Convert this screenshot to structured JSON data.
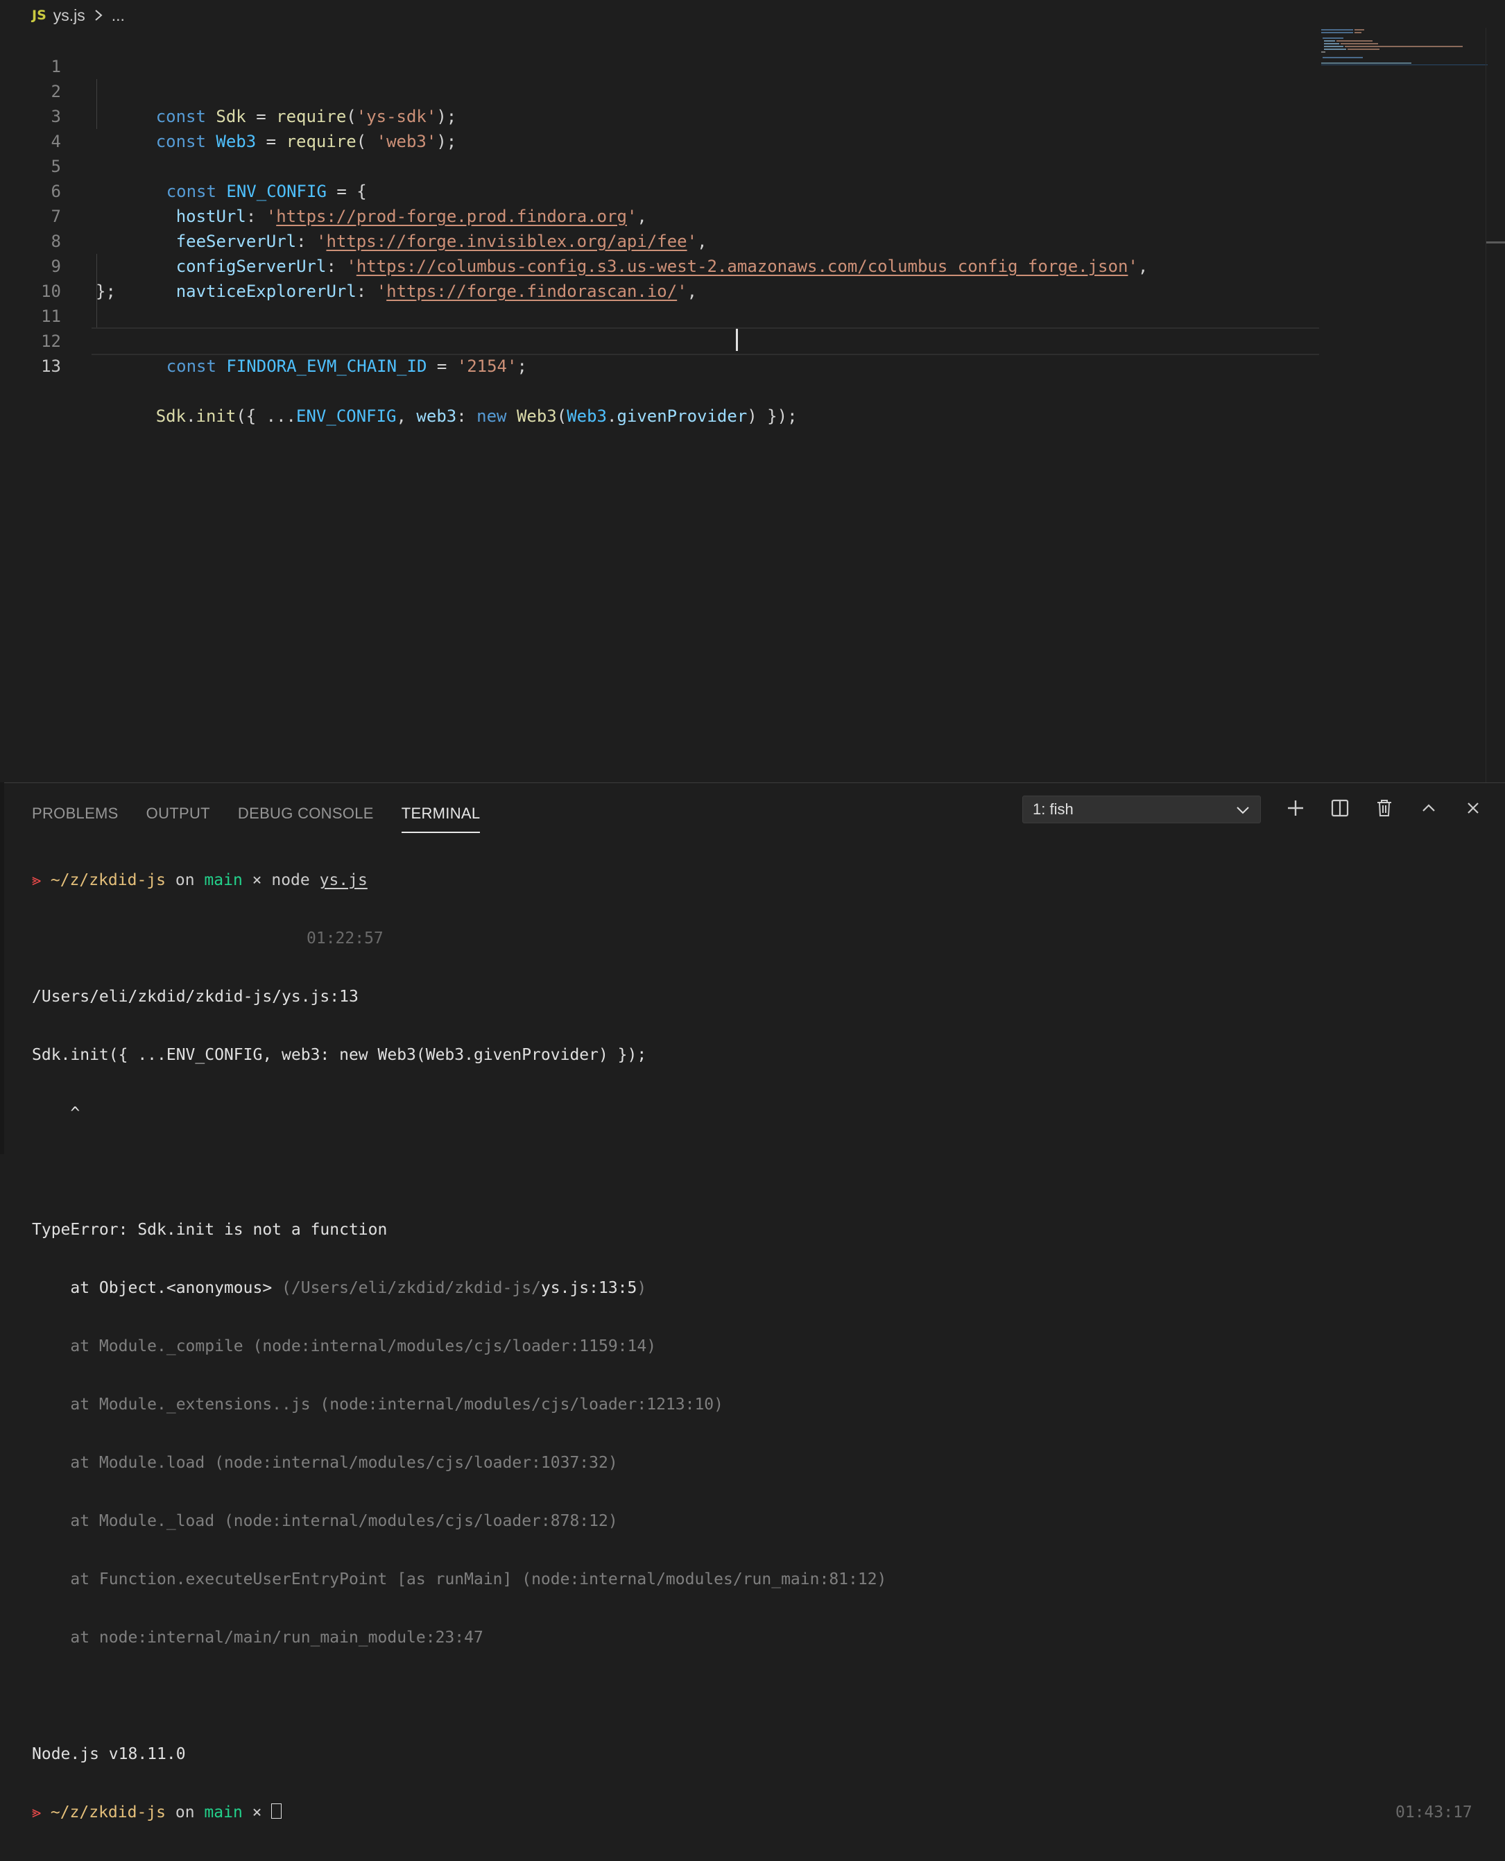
{
  "breadcrumb": {
    "file_icon": "JS",
    "file": "ys.js",
    "separator_icon": "chevron-right-icon",
    "rest": "..."
  },
  "editor": {
    "line_numbers": [
      "1",
      "2",
      "3",
      "4",
      "5",
      "6",
      "7",
      "8",
      "9",
      "10",
      "11",
      "12",
      "13"
    ],
    "code": {
      "l1": {
        "kw": "const",
        "name": "Sdk",
        "eq": " = ",
        "fn": "require",
        "open": "(",
        "q1": "'",
        "str": "ys-sdk",
        "q2": "'",
        "close": ");"
      },
      "l2": {
        "kw": "const",
        "name": "Web3",
        "eq": " = ",
        "fn": "require",
        "open": "( ",
        "str": "'web3'",
        "close": ");"
      },
      "l4": {
        "kw": "const",
        "name": "ENV_CONFIG",
        "rest": " = {"
      },
      "l5": {
        "key": "hostUrl",
        "colon": ": ",
        "q1": "'",
        "url": "https://prod-forge.prod.findora.org",
        "q2": "'",
        "comma": ","
      },
      "l6": {
        "key": "feeServerUrl",
        "colon": ": ",
        "q1": "'",
        "url": "https://forge.invisiblex.org/api/fee",
        "q2": "'",
        "comma": ","
      },
      "l7": {
        "key": "configServerUrl",
        "colon": ": ",
        "q1": "'",
        "url": "https://columbus-config.s3.us-west-2.amazonaws.com/columbus_config_forge.json",
        "q2": "'",
        "comma": ","
      },
      "l8": {
        "key": "navticeExplorerUrl",
        "colon": ": ",
        "q1": "'",
        "url": "https://forge.findorascan.io/",
        "q2": "'",
        "comma": ","
      },
      "l9": {
        "text": "};"
      },
      "l11": {
        "kw": "const",
        "name": "FINDORA_EVM_CHAIN_ID",
        "eq": " = ",
        "str": "'2154'",
        "semi": ";"
      },
      "l13": {
        "obj": "Sdk",
        "dot": ".",
        "fn": "init",
        "open": "({ ...",
        "spread": "ENV_CONFIG",
        "comma": ", ",
        "key": "web3",
        "colon": ": ",
        "kw": "new",
        "cls": "Web3",
        "p": "(",
        "obj2": "Web3",
        "dot2": ".",
        "prop": "givenProvider",
        "end": ") });"
      }
    }
  },
  "panel": {
    "tabs": [
      "PROBLEMS",
      "OUTPUT",
      "DEBUG CONSOLE",
      "TERMINAL"
    ],
    "active_tab": "TERMINAL",
    "terminal_select": "1: fish",
    "buttons": [
      "plus-icon",
      "split-icon",
      "trash-icon",
      "chevron-up-icon",
      "close-icon"
    ]
  },
  "terminal": {
    "prompt_arrow": "⪢",
    "prompt_path": "~/z/zkdid-js",
    "prompt_on": " on ",
    "prompt_branch": "main",
    "prompt_x": " × ",
    "cmd": "node ",
    "cmd_arg": "ys.js",
    "time1": "01:22:57",
    "err_loc": "/Users/eli/zkdid/zkdid-js/ys.js:13",
    "err_src": "Sdk.init({ ...ENV_CONFIG, web3: new Web3(Web3.givenProvider) });",
    "err_caret": "    ^",
    "err_type": "TypeError: Sdk.init is not a function",
    "stack0_a": "    at Object.<anonymous> ",
    "stack0_b": "(/Users/eli/zkdid/zkdid-js/",
    "stack0_c": "ys.js:13:5",
    "stack0_d": ")",
    "stack": [
      "    at Module._compile (node:internal/modules/cjs/loader:1159:14)",
      "    at Module._extensions..js (node:internal/modules/cjs/loader:1213:10)",
      "    at Module.load (node:internal/modules/cjs/loader:1037:32)",
      "    at Module._load (node:internal/modules/cjs/loader:878:12)"
    ],
    "stack5_a": "    at Function.executeUserEntryPoint ",
    "stack5_b": "[as runMain] (node:internal/modules/run_main:81:12)",
    "stack6_a": "    at node:internal/main/run_main_module:23:47",
    "node_version": "Node.js v18.11.0",
    "time2": "01:43:17"
  }
}
